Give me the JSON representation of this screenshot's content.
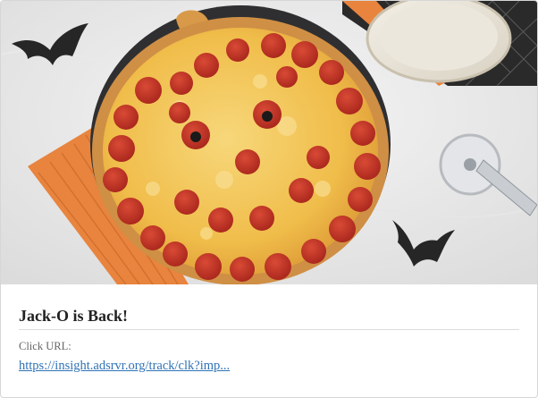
{
  "card": {
    "image_alt": "Jack-O-Lantern pizza with Halloween bats",
    "title": "Jack-O is Back!",
    "click_url_label": "Click URL:",
    "click_url": "https://insight.adsrvr.org/track/clk?imp..."
  },
  "colors": {
    "link": "#2f72b5",
    "title": "#222222",
    "label": "#666666",
    "napkin": "#e8843e",
    "pepperoni": "#c8372a",
    "cheese": "#f2c14e"
  },
  "icons": [
    "bat-icon",
    "pizza-cutter-icon"
  ]
}
